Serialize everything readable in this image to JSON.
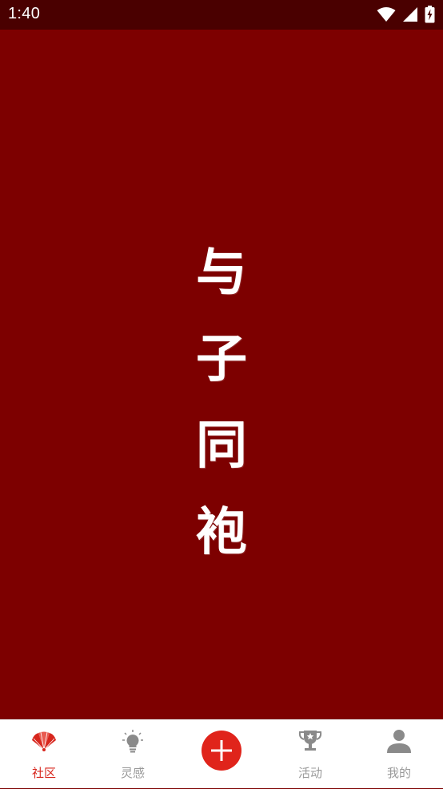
{
  "status_bar": {
    "time": "1:40",
    "icons": [
      "wifi-icon",
      "signal-icon",
      "battery-charging-icon"
    ]
  },
  "splash": {
    "title_chars": [
      "与",
      "子",
      "同",
      "袍"
    ],
    "background_color": "#7d0000"
  },
  "tab_bar": {
    "tabs": [
      {
        "label": "社区",
        "icon": "fan-icon",
        "active": true
      },
      {
        "label": "灵感",
        "icon": "lightbulb-icon",
        "active": false
      },
      {
        "label": "",
        "icon": "plus-icon",
        "active": false
      },
      {
        "label": "活动",
        "icon": "trophy-icon",
        "active": false
      },
      {
        "label": "我的",
        "icon": "user-icon",
        "active": false
      }
    ],
    "active_color": "#d7261d",
    "inactive_color": "#9a9a9a",
    "add_button_color": "#e0241b"
  }
}
